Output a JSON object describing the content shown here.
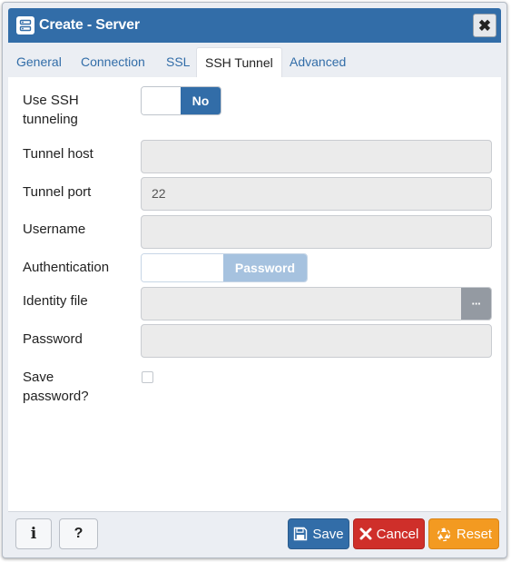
{
  "dialog": {
    "title": "Create - Server",
    "close_glyph": "✖",
    "icon": "server-icon"
  },
  "tabs": [
    {
      "label": "General",
      "active": false
    },
    {
      "label": "Connection",
      "active": false
    },
    {
      "label": "SSL",
      "active": false
    },
    {
      "label": "SSH Tunnel",
      "active": true
    },
    {
      "label": "Advanced",
      "active": false
    }
  ],
  "form": {
    "use_ssh": {
      "label_line1": "Use SSH",
      "label_line2": "tunneling",
      "value": "No"
    },
    "tunnel_host": {
      "label": "Tunnel host",
      "value": ""
    },
    "tunnel_port": {
      "label": "Tunnel port",
      "value": "22"
    },
    "username": {
      "label": "Username",
      "value": ""
    },
    "authentication": {
      "label": "Authentication",
      "value": "Password"
    },
    "identity_file": {
      "label": "Identity file",
      "value": "",
      "browse_glyph": "···"
    },
    "password": {
      "label": "Password",
      "value": ""
    },
    "save_password": {
      "label_line1": "Save",
      "label_line2": "password?",
      "checked": false
    }
  },
  "footer": {
    "info_glyph": "i",
    "help_glyph": "?",
    "save_label": "Save",
    "cancel_label": "Cancel",
    "reset_label": "Reset"
  },
  "colors": {
    "primary": "#326da8",
    "danger": "#cf2f2a",
    "warning": "#f39a21",
    "disabled_toggle": "#a6c2df"
  }
}
